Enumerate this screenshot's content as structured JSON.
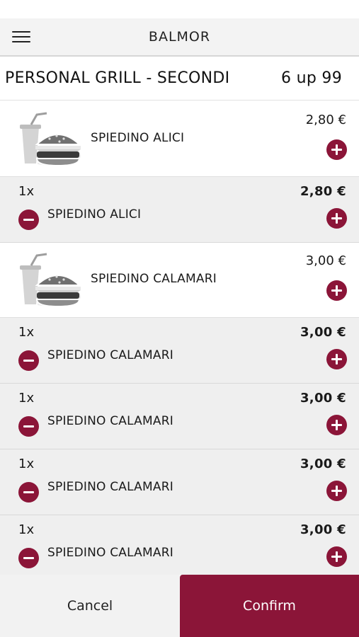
{
  "header": {
    "title": "BALMOR",
    "menu_icon": "hamburger-menu-icon"
  },
  "section": {
    "title": "PERSONAL GRILL - SECONDI",
    "table": "6 up 99"
  },
  "products": [
    {
      "name": "SPIEDINO ALICI",
      "price": "2,80 €",
      "image_icon": "burger-and-drink-icon",
      "orders": [
        {
          "qty": "1x",
          "name": "SPIEDINO ALICI",
          "price": "2,80 €"
        }
      ]
    },
    {
      "name": "SPIEDINO CALAMARI",
      "price": "3,00 €",
      "image_icon": "burger-and-drink-icon",
      "orders": [
        {
          "qty": "1x",
          "name": "SPIEDINO CALAMARI",
          "price": "3,00 €"
        },
        {
          "qty": "1x",
          "name": "SPIEDINO CALAMARI",
          "price": "3,00 €"
        },
        {
          "qty": "1x",
          "name": "SPIEDINO CALAMARI",
          "price": "3,00 €"
        },
        {
          "qty": "1x",
          "name": "SPIEDINO CALAMARI",
          "price": "3,00 €"
        }
      ]
    }
  ],
  "footer": {
    "cancel_label": "Cancel",
    "confirm_label": "Confirm"
  },
  "colors": {
    "accent": "#8b1538",
    "header_bg": "#f3f3f3",
    "order_row_bg": "#efefef"
  }
}
